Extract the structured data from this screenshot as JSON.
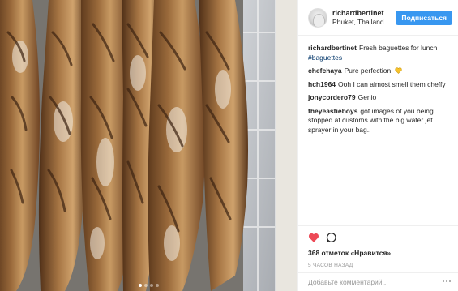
{
  "post": {
    "username": "richardbertinet",
    "location": "Phuket, Thailand",
    "follow_label": "Подписаться",
    "caption": "Fresh baguettes for lunch",
    "hashtag": "#baguettes",
    "carousel_dots": 4,
    "carousel_active": 0
  },
  "comments": [
    {
      "user": "chefchaya",
      "text": "Pure perfection",
      "emoji": "yellow-heart"
    },
    {
      "user": "hch1964",
      "text": "Ooh I can almost smell them cheffy"
    },
    {
      "user": "jonycordero79",
      "text": "Genio"
    },
    {
      "user": "theyeastieboys",
      "text": "got images of you being stopped at customs with the big water jet sprayer in your bag.."
    }
  ],
  "actions": {
    "likes_text": "368 отметок «Нравится»",
    "time_ago": "5 часов назад",
    "comment_placeholder": "Добавьте комментарий...",
    "liked": true,
    "heart_color": "#ed4956"
  },
  "colors": {
    "follow_bg": "#3897f0",
    "hashtag": "#003569",
    "muted": "#999999"
  }
}
